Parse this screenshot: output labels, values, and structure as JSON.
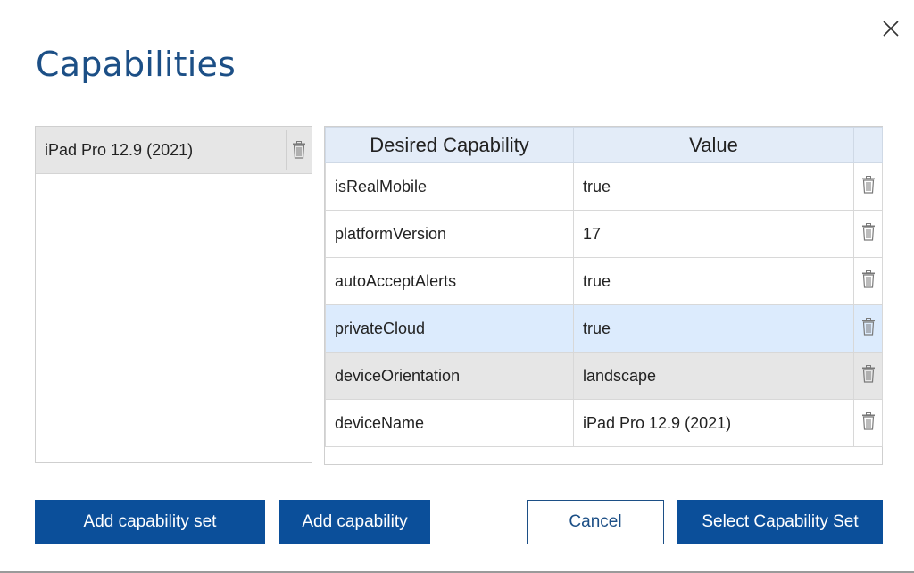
{
  "dialog": {
    "title": "Capabilities",
    "close_icon": "close-icon"
  },
  "sets": [
    {
      "label": "iPad Pro 12.9 (2021)",
      "icon": "trash-icon"
    }
  ],
  "table": {
    "headers": [
      "Desired Capability",
      "Value",
      ""
    ],
    "rows": [
      {
        "capability": "isRealMobile",
        "value": "true"
      },
      {
        "capability": "platformVersion",
        "value": "17"
      },
      {
        "capability": "autoAcceptAlerts",
        "value": "true"
      },
      {
        "capability": "privateCloud",
        "value": "true"
      },
      {
        "capability": "deviceOrientation",
        "value": "landscape"
      },
      {
        "capability": "deviceName",
        "value": "iPad Pro 12.9 (2021)"
      }
    ]
  },
  "buttons": {
    "add_set": "Add capability set",
    "add_capability": "Add capability",
    "cancel": "Cancel",
    "select_set": "Select Capability Set"
  },
  "colors": {
    "accent": "#0b4f9a",
    "title": "#1c4f86",
    "selected_row": "#dcebfd",
    "hover_row": "#e6e6e6",
    "header_bg": "#e3ecf8"
  }
}
